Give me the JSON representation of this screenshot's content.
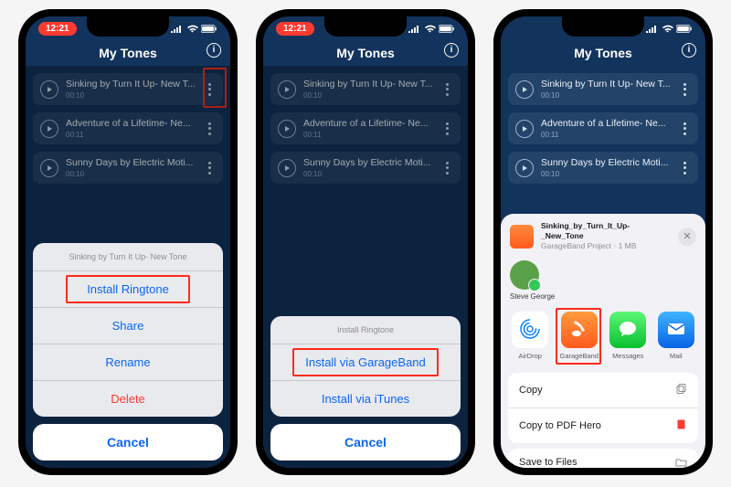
{
  "status": {
    "clock": "12:21"
  },
  "header": {
    "title": "My Tones"
  },
  "tones": [
    {
      "title": "Sinking by Turn It Up- New T...",
      "duration": "00:10"
    },
    {
      "title": "Adventure of a Lifetime- Ne...",
      "duration": "00:11"
    },
    {
      "title": "Sunny Days by Electric Moti...",
      "duration": "00:10"
    }
  ],
  "sheet1": {
    "title": "Sinking by Turn It Up- New Tone",
    "options": {
      "install": "Install Ringtone",
      "share": "Share",
      "rename": "Rename",
      "delete": "Delete"
    },
    "cancel": "Cancel"
  },
  "sheet2": {
    "title": "Install Ringtone",
    "options": {
      "garageband": "Install via GarageBand",
      "itunes": "Install via iTunes"
    },
    "cancel": "Cancel"
  },
  "share": {
    "filename": "Sinking_by_Turn_It_Up-_New_Tone",
    "sub": "GarageBand Project · 1 MB",
    "contact": "Steve George",
    "apps": {
      "airdrop": "AirDrop",
      "garageband": "GarageBand",
      "messages": "Messages",
      "mail": "Mail"
    },
    "actions": {
      "copy": "Copy",
      "pdfhero": "Copy to PDF Hero",
      "save": "Save to Files"
    }
  }
}
